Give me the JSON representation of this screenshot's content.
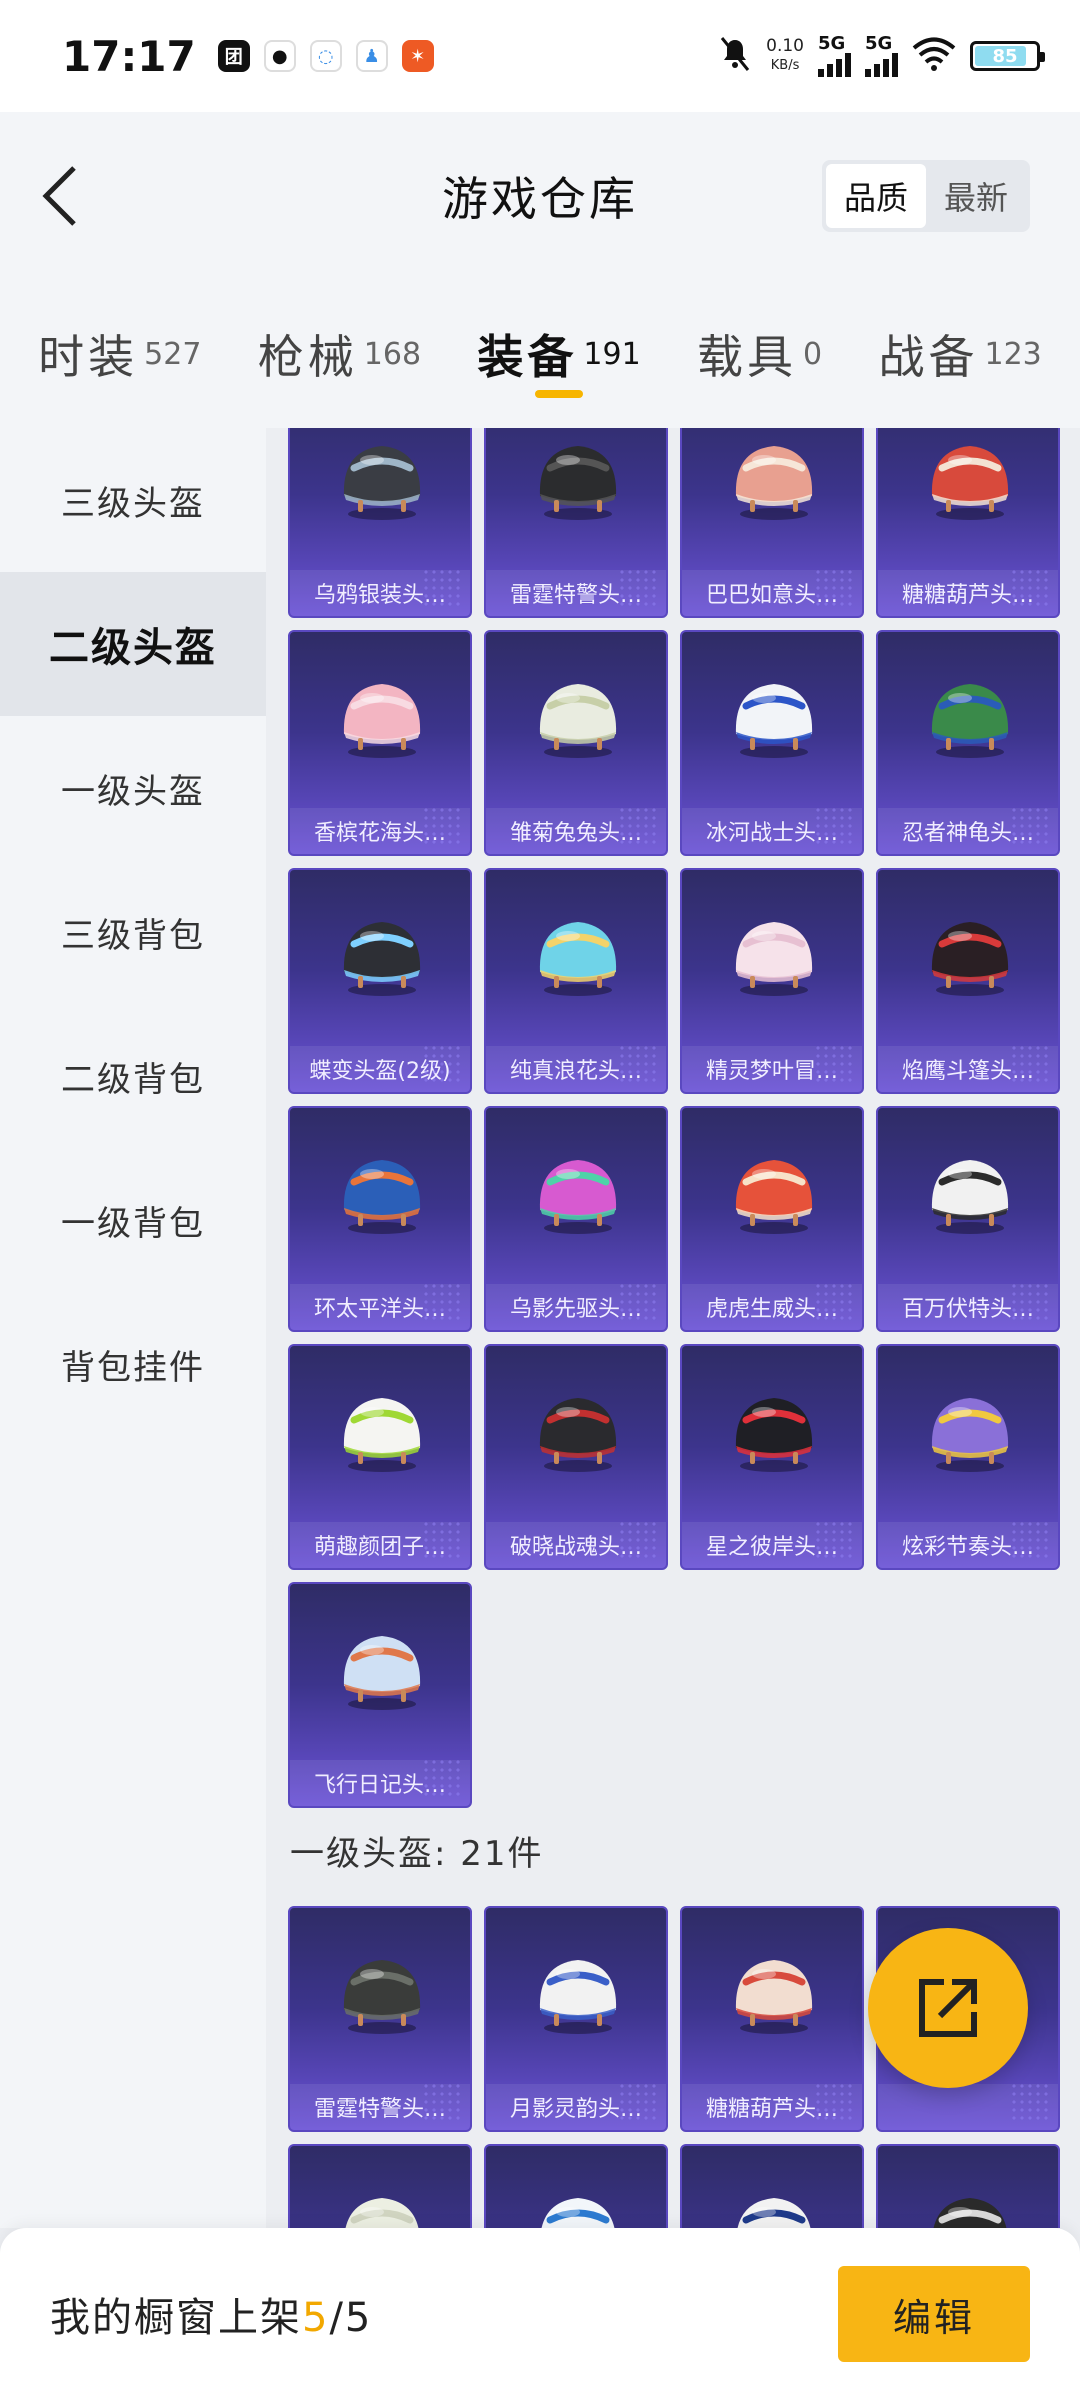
{
  "status_bar": {
    "time": "17:17",
    "apps": [
      {
        "icon": "meituan-icon",
        "glyph": "团",
        "bg": "#111111",
        "fg": "#ffffff"
      },
      {
        "icon": "wechat-icon",
        "glyph": "●",
        "bg": "#ffffff",
        "fg": "#111111"
      },
      {
        "icon": "chat-bubble-icon",
        "glyph": "◌",
        "bg": "#ffffff",
        "fg": "#3a8ee6"
      },
      {
        "icon": "qq-icon",
        "glyph": "♟",
        "bg": "#ffffff",
        "fg": "#3a8ee6"
      },
      {
        "icon": "game-app-icon",
        "glyph": "✶",
        "bg": "#ee5a24",
        "fg": "#ffffff"
      }
    ],
    "net_speed_value": "0.10",
    "net_speed_unit": "KB/s",
    "signal_1_label": "5G",
    "signal_2_label": "5G",
    "battery_level": "85",
    "battery_fraction": 0.85,
    "colors": {
      "battery_fill": "#8fdcf0"
    }
  },
  "header": {
    "title": "游戏仓库",
    "sort_options": [
      "品质",
      "最新"
    ],
    "active_sort": 0
  },
  "tabs": [
    {
      "label": "时装",
      "count": "527",
      "active": false
    },
    {
      "label": "枪械",
      "count": "168",
      "active": false
    },
    {
      "label": "装备",
      "count": "191",
      "active": true
    },
    {
      "label": "载具",
      "count": "0",
      "active": false
    },
    {
      "label": "战备",
      "count": "123",
      "active": false
    }
  ],
  "sidebar": {
    "items": [
      {
        "label": "三级头盔",
        "active": false
      },
      {
        "label": "二级头盔",
        "active": true
      },
      {
        "label": "一级头盔",
        "active": false
      },
      {
        "label": "三级背包",
        "active": false
      },
      {
        "label": "二级背包",
        "active": false
      },
      {
        "label": "一级背包",
        "active": false
      },
      {
        "label": "背包挂件",
        "active": false
      }
    ]
  },
  "level2_helmets": [
    {
      "label": "乌鸦银装头…",
      "color": "#3a3d44",
      "accent": "#9fb6c8"
    },
    {
      "label": "雷霆特警头…",
      "color": "#2b2c2e",
      "accent": "#555555"
    },
    {
      "label": "巴巴如意头…",
      "color": "#e8a090",
      "accent": "#f6e6d8"
    },
    {
      "label": "糖糖葫芦头…",
      "color": "#d84a3c",
      "accent": "#f3e2d2"
    },
    {
      "label": "香槟花海头…",
      "color": "#f3b5c2",
      "accent": "#f8dbe2"
    },
    {
      "label": "雏菊兔兔头…",
      "color": "#e9ece0",
      "accent": "#c7cfa8"
    },
    {
      "label": "冰河战士头…",
      "color": "#f2f4f8",
      "accent": "#2c55c8"
    },
    {
      "label": "忍者神龟头…",
      "color": "#3a8a4a",
      "accent": "#2a5cb8"
    },
    {
      "label": "蝶变头盔(2级)",
      "color": "#2d2f35",
      "accent": "#7fd0ff"
    },
    {
      "label": "纯真浪花头…",
      "color": "#6fd3e8",
      "accent": "#f3d36a"
    },
    {
      "label": "精灵梦叶冒…",
      "color": "#f6e2ea",
      "accent": "#e7c0d2"
    },
    {
      "label": "焰鹰斗篷头…",
      "color": "#2a1f24",
      "accent": "#d83a3a"
    },
    {
      "label": "环太平洋头…",
      "color": "#2b5fb8",
      "accent": "#e8743a"
    },
    {
      "label": "乌影先驱头…",
      "color": "#d75ad0",
      "accent": "#4fd2a8"
    },
    {
      "label": "虎虎生威头…",
      "color": "#e6523a",
      "accent": "#f7e2c8"
    },
    {
      "label": "百万伏特头…",
      "color": "#f1f1f1",
      "accent": "#2b2b2b"
    },
    {
      "label": "萌趣颜团子…",
      "color": "#f5f5f2",
      "accent": "#9fd834"
    },
    {
      "label": "破晓战魂头…",
      "color": "#2a2a2e",
      "accent": "#c23030"
    },
    {
      "label": "星之彼岸头…",
      "color": "#1f1f25",
      "accent": "#e0303a"
    },
    {
      "label": "炫彩节奏头…",
      "color": "#8a70d8",
      "accent": "#f0c840"
    },
    {
      "label": "飞行日记头…",
      "color": "#cfe0f4",
      "accent": "#e0784a"
    }
  ],
  "level1_section": {
    "title": "一级头盔: 21件"
  },
  "level1_helmets": [
    {
      "label": "雷霆特警头…",
      "color": "#3a3c3a",
      "accent": "#6a6f68"
    },
    {
      "label": "月影灵韵头…",
      "color": "#f2f2f2",
      "accent": "#3a5fc8"
    },
    {
      "label": "糖糖葫芦头…",
      "color": "#f2ddd0",
      "accent": "#d84a3c"
    },
    {
      "label": "",
      "color": "#f3b8c6",
      "accent": "#f7dbe3"
    },
    {
      "label": "",
      "color": "#ecefe2",
      "accent": "#d0d4c0"
    },
    {
      "label": "",
      "color": "#f2f6fa",
      "accent": "#2c7ad0"
    },
    {
      "label": "",
      "color": "#f2f2f2",
      "accent": "#1f3a8a"
    },
    {
      "label": "",
      "color": "#2a2a2a",
      "accent": "#d8d8d8"
    }
  ],
  "bottom_bar": {
    "prefix": "我的橱窗上架",
    "current": "5",
    "total": "/5",
    "edit_label": "编辑"
  }
}
